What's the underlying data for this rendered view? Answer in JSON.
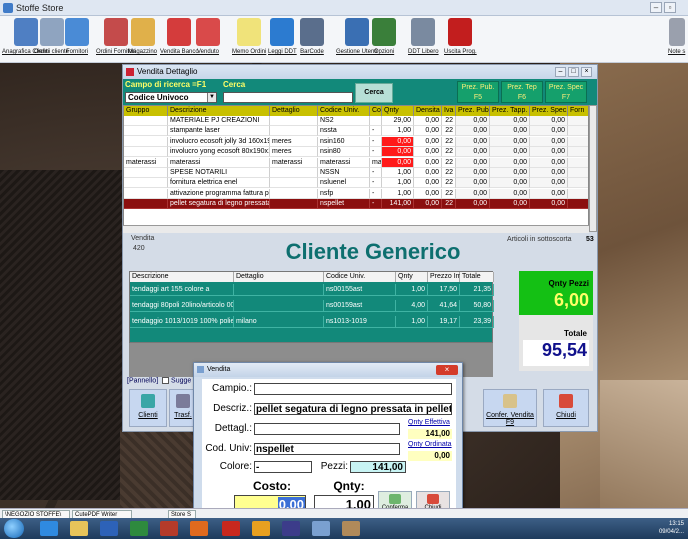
{
  "app": {
    "title": "Stoffe Store"
  },
  "toolbar": [
    {
      "label": "Anagrafica Clienti",
      "name": "anagrafica-clienti",
      "color": "#4f7fc3"
    },
    {
      "label": "Ordini cliente",
      "name": "ordini-cliente",
      "color": "#8fa4c0"
    },
    {
      "label": "Fornitori",
      "name": "fornitori",
      "color": "#4a8bd6"
    },
    {
      "label": "Ordini Fornitori",
      "name": "ordini-fornitori",
      "color": "#c44b4b"
    },
    {
      "label": "Magazzino",
      "name": "magazzino",
      "color": "#e0b04a"
    },
    {
      "label": "Vendita Banco",
      "name": "vendita-banco",
      "color": "#d43c3c"
    },
    {
      "label": "Venduto",
      "name": "venduto",
      "color": "#d94a4a"
    },
    {
      "label": "Memo Ordini",
      "name": "memo-ordini",
      "color": "#f0e37a"
    },
    {
      "label": "Leggi DDT",
      "name": "leggi-ddt",
      "color": "#2c7bd0"
    },
    {
      "label": "BarCode",
      "name": "barcode",
      "color": "#5a6e8c"
    },
    {
      "label": "Gestione Utenti",
      "name": "gestione-utenti",
      "color": "#3a6fb3"
    },
    {
      "label": "Opzioni",
      "name": "opzioni",
      "color": "#3a7f3a"
    },
    {
      "label": "DDT Libero",
      "name": "ddt-libero",
      "color": "#7a8aa0"
    },
    {
      "label": "Uscita Prog.",
      "name": "uscita-prog",
      "color": "#c21e1e"
    }
  ],
  "toolbar_right": {
    "label": "Note s"
  },
  "vendita_window": {
    "title": "Vendita Dettaglio",
    "campo_label": "Campo di ricerca =F1",
    "campo_value": "Codice Univoco",
    "cerca_label": "Cerca",
    "cerca_button": "Cerca",
    "fbuttons": [
      {
        "l1": "Prez. Pub.",
        "l2": "F5"
      },
      {
        "l1": "Prez. Tep",
        "l2": "F6"
      },
      {
        "l1": "Prez. Spec",
        "l2": "F7"
      }
    ],
    "columns": [
      "Gruppo",
      "Descrizione",
      "Dettaglio",
      "Codice Univ.",
      "Col",
      "Qnty",
      "Densita",
      "Iva",
      "Prez. Pubb.",
      "Prez. Tapp.",
      "Prez. Spec.",
      "Forn"
    ],
    "rows": [
      [
        "",
        "MATERIALE PJ CREAZIONI",
        "",
        "NS2",
        "",
        "29,00",
        "0,00",
        "22",
        "0,00",
        "0,00",
        "0,00",
        ""
      ],
      [
        "",
        "stampante laser",
        "",
        "nssta",
        "-",
        "1,00",
        "0,00",
        "22",
        "0,00",
        "0,00",
        "0,00",
        ""
      ],
      [
        "",
        "involucro ecosoft jolly 3d 160x190x",
        "meres",
        "nsin160",
        "-",
        "0,00",
        "0,00",
        "22",
        "0,00",
        "0,00",
        "0,00",
        ""
      ],
      [
        "",
        "involucro yong ecosoft 80x190x18",
        "meres",
        "nsin80",
        "-",
        "0,00",
        "0,00",
        "22",
        "0,00",
        "0,00",
        "0,00",
        ""
      ],
      [
        "materassi",
        "materassi",
        "materassi",
        "materassi",
        "mat",
        "0,00",
        "0,00",
        "22",
        "0,00",
        "0,00",
        "0,00",
        ""
      ],
      [
        "",
        "SPESE NOTARILI",
        "",
        "NSSN",
        "-",
        "1,00",
        "0,00",
        "22",
        "0,00",
        "0,00",
        "0,00",
        ""
      ],
      [
        "",
        "fornitura elettrica enel",
        "",
        "nsluenel",
        "-",
        "1,00",
        "0,00",
        "22",
        "0,00",
        "0,00",
        "0,00",
        ""
      ],
      [
        "",
        "attivazione programma fattura pro",
        "",
        "nsfp",
        "-",
        "1,00",
        "0,00",
        "22",
        "0,00",
        "0,00",
        "0,00",
        ""
      ],
      [
        "",
        "pellet segatura di legno pressata i",
        "",
        "nspellet",
        "-",
        "141,00",
        "0,00",
        "22",
        "0,00",
        "0,00",
        "0,00",
        ""
      ]
    ],
    "vendita_label": "Vendita",
    "vendita_number": "420",
    "articoli_label": "Articoli in sottoscorta",
    "articoli_count": "53",
    "cliente": "Cliente Generico",
    "grid2_columns": [
      "Descrizione",
      "Dettaglio",
      "Codice Univ.",
      "Qnty",
      "Prezzo Imp.",
      "Totale"
    ],
    "grid2_rows": [
      [
        "tendaggi art 155 colore a",
        "",
        "ns00155ast",
        "1,00",
        "17,50",
        "21,35"
      ],
      [
        "tendaggi 80poli 20lino/articolo 001",
        "",
        "ns00159ast",
        "4,00",
        "41,64",
        "50,80"
      ],
      [
        "tendaggio 1013/1019 100% poliestr",
        "milano",
        "ns1013-1019",
        "1,00",
        "19,17",
        "23,39"
      ]
    ],
    "qnty_pezzi_label": "Qnty Pezzi",
    "qnty_pezzi_value": "6,00",
    "totale_label": "Totale",
    "totale_value": "95,54",
    "pannello_label": "[Pannello]",
    "sugg_label": "Sugge",
    "bottom_buttons": [
      {
        "label": "Clienti"
      },
      {
        "label": "Trasf."
      },
      {
        "label": "Confer. Vendita F9"
      },
      {
        "label": "Chiudi"
      }
    ]
  },
  "dialog": {
    "title": "Vendita",
    "campo_label": "Campio.:",
    "descr_label": "Descriz.:",
    "descr_value": "pellet segatura di legno pressata in pellet",
    "dettagl_label": "Dettagl.:",
    "coduniv_label": "Cod. Univ:",
    "coduniv_value": "nspellet",
    "colore_label": "Colore:",
    "colore_value": "-",
    "pezzi_label": "Pezzi:",
    "pezzi_value": "141,00",
    "qnty_eff_label": "Qnty Effettiva",
    "qnty_eff_value": "141,00",
    "qnty_ord_label": "Qnty Ordinata",
    "qnty_ord_value": "0,00",
    "costo_label": "Costo:",
    "costo_value": "0,00",
    "qnty_label": "Qnty:",
    "qnty_value": "1,00",
    "conferma_label": "Conferma",
    "chiudi_label": "Chiudi"
  },
  "taskbar": {
    "tasks": [
      "\\NEGOZIO STOFFE\\",
      "CutePDF Writer",
      "Store S"
    ],
    "clock_time": "13:15",
    "clock_date": "09/04/2..."
  }
}
